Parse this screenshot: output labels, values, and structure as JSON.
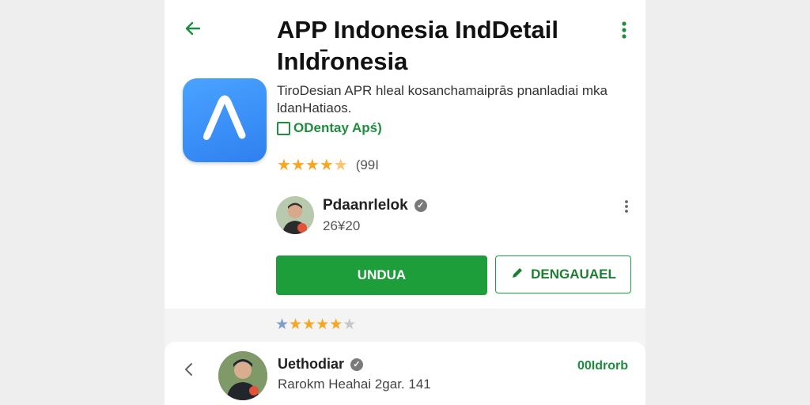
{
  "app": {
    "title": "APP Indonesia IndDetail InIdr̄onesia",
    "description": "TiroDesian APR hleal kosanchamaiprās pnanladiai mka ldanHatiaos.",
    "badge": "ODentay Apś)",
    "rating_stars": 4.5,
    "rating_count": "(99I"
  },
  "developer": {
    "name": "Pdaanrlelok",
    "count": "26¥20"
  },
  "buttons": {
    "install": "UNDUA",
    "edit": "DENGAUAEL"
  },
  "review_summary": {
    "stars": 4.5
  },
  "review": {
    "author": "Uethodiar",
    "meta": "Rarokm Heahai 2gar. 141",
    "link": "00Idrorb"
  },
  "colors": {
    "accent_green": "#1e9e3a",
    "star": "#f6a623",
    "icon_blue": "#2f80f0"
  },
  "icons": {
    "back": "arrow-left-icon",
    "overflow": "more-vert-icon",
    "verified": "verified-icon",
    "edit": "pencil-icon"
  }
}
